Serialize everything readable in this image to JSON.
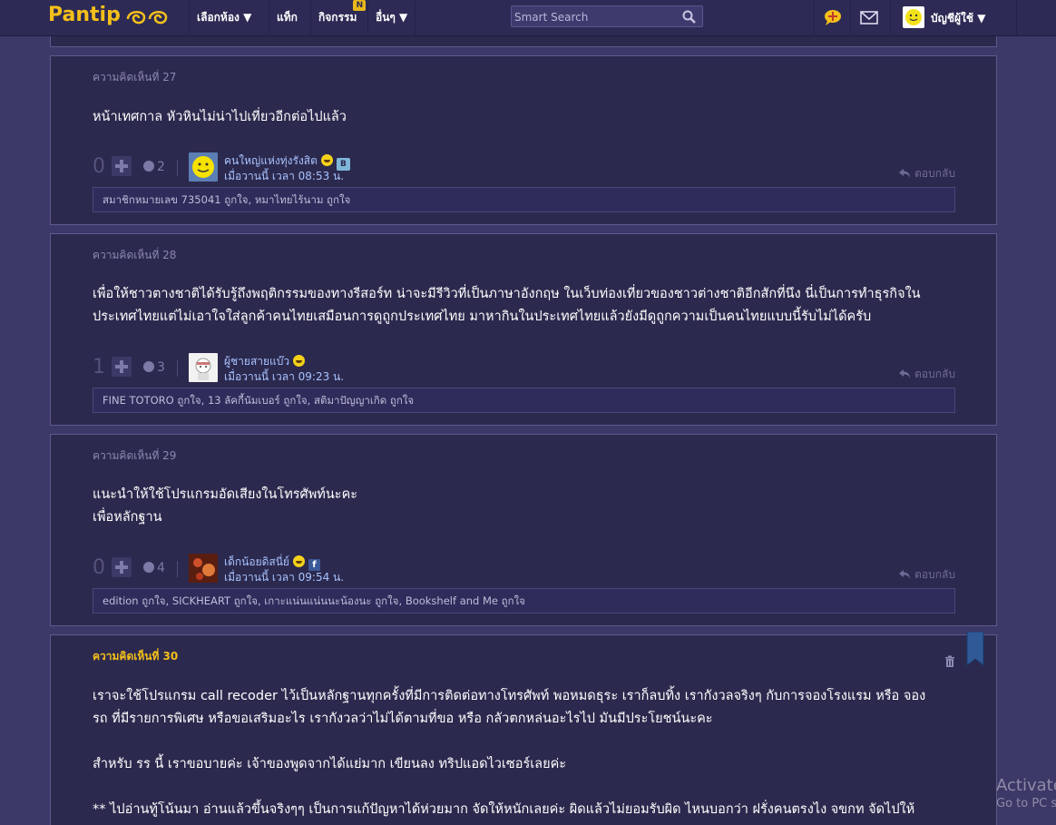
{
  "topbar": {
    "logo": "Pantip",
    "nav": [
      {
        "label": "เลือกห้อง ▼"
      },
      {
        "label": "แท็ก"
      },
      {
        "label": "กิจกรรม",
        "badge": "N"
      },
      {
        "label": "อื่นๆ ▼"
      }
    ],
    "search_placeholder": "Smart Search",
    "user_label": "บัญชีผู้ใช้ ▼",
    "icons": [
      "pantip-point-icon",
      "mail-icon",
      "search-icon"
    ]
  },
  "comments": [
    {
      "number": "ความคิดเห็นที่ 27",
      "body": [
        "หน้าเทศกาล หัวหินไม่น่าไปเที่ยวอีกต่อไปแล้ว"
      ],
      "votes": "0",
      "emotions": "2",
      "author": "คนใหญ่แห่งทุ่งรังสิต",
      "time": "เมื่อวานนี้ เวลา 08:53 น.",
      "reply": "ตอบกลับ",
      "likes": "สมาชิกหมายเลข 735041 ถูกใจ, หมาไทยไร้นาม ถูกใจ"
    },
    {
      "number": "ความคิดเห็นที่ 28",
      "body": [
        "เพื่อให้ชาวตางชาติได้รับรู้ถึงพฤติกรรมของทางรีสอร์ท น่าจะมีรีวิวที่เป็นภาษาอังกฤษ ในเว็บท่องเที่ยวของชาวต่างชาติอีกสักที่นึง นี่เป็นการทำธุรกิจใน",
        "ประเทศไทยแต่ไม่เอาใจใส่ลูกค้าคนไทยเสมือนการดูถูกประเทศไทย มาหากินในประเทศไทยแล้วยังมีดูถูกความเป็นคนไทยแบบนี้รับไม่ได้ครับ"
      ],
      "votes": "1",
      "emotions": "3",
      "author": "ผู้ชายสายแบ๊ว",
      "time": "เมื่อวานนี้ เวลา 09:23 น.",
      "reply": "ตอบกลับ",
      "likes": "FINE TOTORO ถูกใจ, 13 ลัคกี้นัมเบอร์ ถูกใจ, สติมาปัญญาเกิด ถูกใจ"
    },
    {
      "number": "ความคิดเห็นที่ 29",
      "body": [
        "แนะนำให้ใช้โปรแกรมอัดเสียงในโทรศัพท์นะคะ",
        "เพื่อหลักฐาน"
      ],
      "votes": "0",
      "emotions": "4",
      "author": "เด็กน้อยดิสนี่ย์",
      "time": "เมื่อวานนี้ เวลา 09:54 น.",
      "reply": "ตอบกลับ",
      "likes": "edition ถูกใจ, SICKHEART ถูกใจ, เกาะแน่นแน่นนะน้องนะ ถูกใจ, Bookshelf and Me ถูกใจ"
    },
    {
      "number": "ความคิดเห็นที่ 30",
      "body": [
        "เราจะใช้โปรแกรม call recoder ไว้เป็นหลักฐานทุกครั้งที่มีการติดต่อทางโทรศัพท์ พอหมดธุระ เราก็ลบทิ้ง เรากังวลจริงๆ กับการจองโรงแรม หรือ จอง",
        "รถ ที่มีรายการพิเศษ หรือขอเสริมอะไร เรากังวลว่าไม่ได้ตามที่ขอ หรือ กลัวตกหล่นอะไรไป  มันมีประโยชน์นะคะ",
        "",
        "สำหรับ รร นี้ เราขอบายค่ะ เจ้าของพูดจากได้แย่มาก เขียนลง ทริปแอดไวเซอร์เลยค่ะ",
        "",
        "** ไปอ่านทู้โน้นมา อ่านแล้วขึ้นจริงๆๆ เป็นการแก้ปัญหาได้ห่วยมาก จัดให้หนักเลยค่ะ ผิดแล้วไม่ยอมรับผิด ไหนบอกว่า ฝรั่งคนตรงไง จขกท จัดไปให้"
      ]
    }
  ],
  "watermark": {
    "line1": "Activate",
    "line2": "Go to PC s"
  }
}
